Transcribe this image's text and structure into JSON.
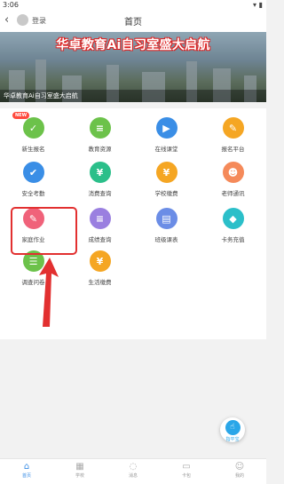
{
  "status_bar": {
    "time": "3:06",
    "icons": "▾ ▮"
  },
  "header": {
    "back_icon": "‹",
    "login": "登录",
    "title": "首页"
  },
  "banner": {
    "headline": "华卓教育Ai自习室盛大启航",
    "caption": "华卓教育Ai自习室盛大启航"
  },
  "grid": [
    {
      "label": "新生报名",
      "icon": "person-icon",
      "glyph": "✓",
      "color": "#6cc24a",
      "badge": "NEW"
    },
    {
      "label": "教育资源",
      "icon": "book-icon",
      "glyph": "≡",
      "color": "#6cc24a"
    },
    {
      "label": "在线课堂",
      "icon": "play-icon",
      "glyph": "▶",
      "color": "#3a8ee6"
    },
    {
      "label": "报名平台",
      "icon": "form-icon",
      "glyph": "✎",
      "color": "#f5a623"
    },
    {
      "label": "安全考勤",
      "icon": "check-icon",
      "glyph": "✔",
      "color": "#3a8ee6"
    },
    {
      "label": "消费查询",
      "icon": "yen-icon",
      "glyph": "¥",
      "color": "#2bbf8a"
    },
    {
      "label": "学校缴费",
      "icon": "coin-icon",
      "glyph": "¥",
      "color": "#f5a623"
    },
    {
      "label": "老师通讯",
      "icon": "contact-icon",
      "glyph": "☻",
      "color": "#f58a5a"
    },
    {
      "label": "家庭作业",
      "icon": "pencil-icon",
      "glyph": "✎",
      "color": "#f0627a"
    },
    {
      "label": "成绩查询",
      "icon": "score-icon",
      "glyph": "≡",
      "color": "#9a7fe0"
    },
    {
      "label": "班级课表",
      "icon": "table-icon",
      "glyph": "▤",
      "color": "#6b8de6"
    },
    {
      "label": "卡务充值",
      "icon": "card-icon",
      "glyph": "◆",
      "color": "#2bbfc9"
    },
    {
      "label": "调查问卷",
      "icon": "survey-icon",
      "glyph": "☰",
      "color": "#6cc24a"
    },
    {
      "label": "生活缴费",
      "icon": "pay-icon",
      "glyph": "¥",
      "color": "#f5a623"
    }
  ],
  "float_button": {
    "label": "指平宝",
    "glyph": "☝"
  },
  "tabbar": [
    {
      "label": "首页",
      "glyph": "⌂",
      "icon": "home-icon",
      "active": true
    },
    {
      "label": "学校",
      "glyph": "▦",
      "icon": "school-icon",
      "active": false
    },
    {
      "label": "消息",
      "glyph": "◌",
      "icon": "message-icon",
      "active": false
    },
    {
      "label": "卡包",
      "glyph": "▭",
      "icon": "card-tab-icon",
      "active": false
    },
    {
      "label": "我的",
      "glyph": "☺",
      "icon": "profile-icon",
      "active": false
    }
  ],
  "annotation_color": "#e23030"
}
